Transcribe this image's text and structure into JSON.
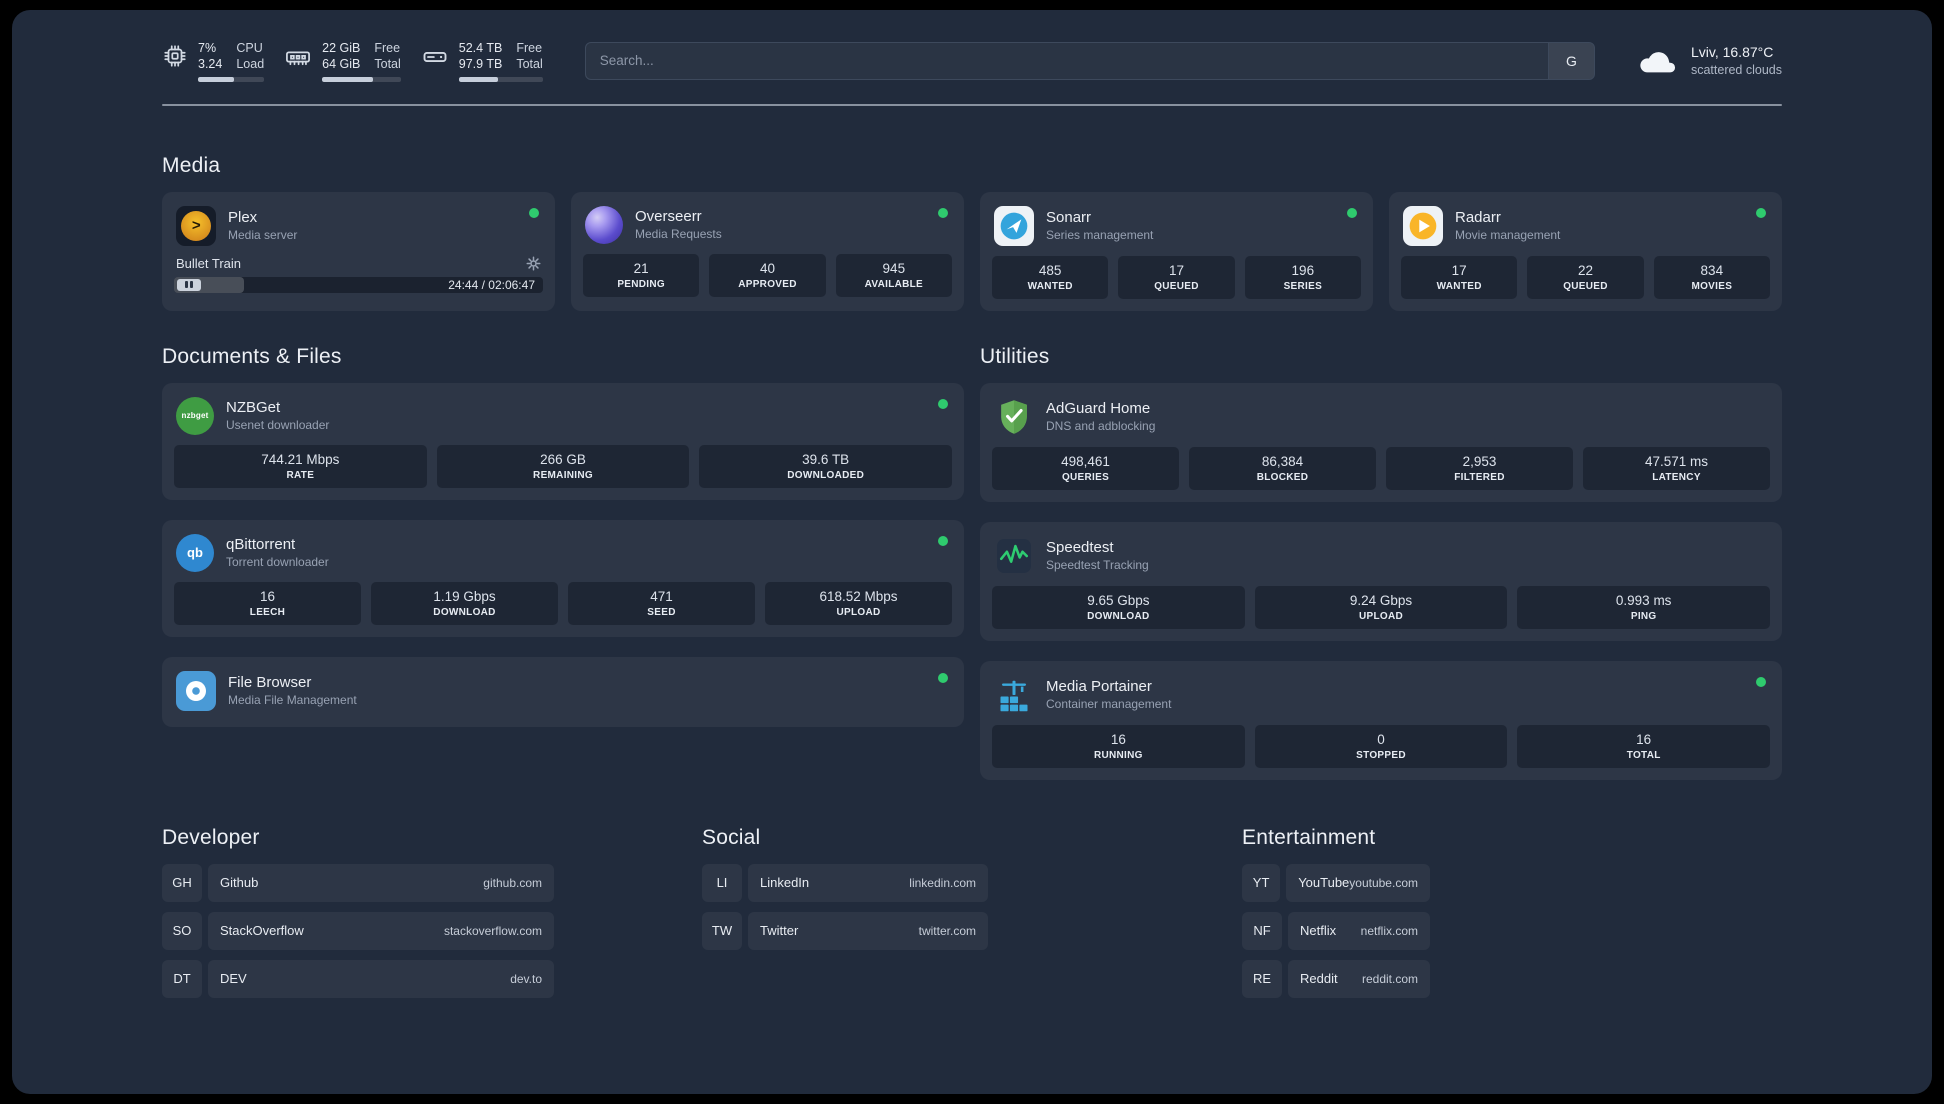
{
  "colors": {
    "background": "#212b3c",
    "card": "rgba(255,255,255,0.055)",
    "status_online": "#2fcb6e",
    "progress_fill": "#c6cedb"
  },
  "icons": {
    "topbar": [
      "cpu-icon",
      "memory-icon",
      "disk-icon"
    ],
    "weather": "cloud-icon",
    "plex_glyph": ">",
    "nzbget_label": "nzbget",
    "qbittorrent_label": "qb"
  },
  "topbar": {
    "cpu": {
      "percent": "7%",
      "load": "3.24",
      "label1": "CPU",
      "label2": "Load",
      "bar_pct": 55
    },
    "memory": {
      "value1": "22 GiB",
      "value2": "64 GiB",
      "label1": "Free",
      "label2": "Total",
      "bar_pct": 65
    },
    "disk": {
      "value1": "52.4 TB",
      "value2": "97.9 TB",
      "label1": "Free",
      "label2": "Total",
      "bar_pct": 47
    },
    "search": {
      "placeholder": "Search...",
      "provider_label": "G"
    },
    "weather": {
      "location": "Lviv, 16.87°C",
      "condition": "scattered clouds"
    }
  },
  "sections": {
    "media": "Media",
    "documents": "Documents & Files",
    "utilities": "Utilities"
  },
  "apps": {
    "plex": {
      "name": "Plex",
      "subtitle": "Media server",
      "player": {
        "title": "Bullet Train",
        "time": "24:44 / 02:06:47",
        "progress_pct": 19
      }
    },
    "overseerr": {
      "name": "Overseerr",
      "subtitle": "Media Requests",
      "stats": [
        {
          "value": "21",
          "label": "PENDING"
        },
        {
          "value": "40",
          "label": "APPROVED"
        },
        {
          "value": "945",
          "label": "AVAILABLE"
        }
      ]
    },
    "sonarr": {
      "name": "Sonarr",
      "subtitle": "Series management",
      "stats": [
        {
          "value": "485",
          "label": "WANTED"
        },
        {
          "value": "17",
          "label": "QUEUED"
        },
        {
          "value": "196",
          "label": "SERIES"
        }
      ]
    },
    "radarr": {
      "name": "Radarr",
      "subtitle": "Movie management",
      "stats": [
        {
          "value": "17",
          "label": "WANTED"
        },
        {
          "value": "22",
          "label": "QUEUED"
        },
        {
          "value": "834",
          "label": "MOVIES"
        }
      ]
    },
    "nzbget": {
      "name": "NZBGet",
      "subtitle": "Usenet downloader",
      "stats": [
        {
          "value": "744.21 Mbps",
          "label": "RATE"
        },
        {
          "value": "266 GB",
          "label": "REMAINING"
        },
        {
          "value": "39.6 TB",
          "label": "DOWNLOADED"
        }
      ]
    },
    "qbittorrent": {
      "name": "qBittorrent",
      "subtitle": "Torrent downloader",
      "stats": [
        {
          "value": "16",
          "label": "LEECH"
        },
        {
          "value": "1.19 Gbps",
          "label": "DOWNLOAD"
        },
        {
          "value": "471",
          "label": "SEED"
        },
        {
          "value": "618.52 Mbps",
          "label": "UPLOAD"
        }
      ]
    },
    "filebrowser": {
      "name": "File Browser",
      "subtitle": "Media File Management"
    },
    "adguard": {
      "name": "AdGuard Home",
      "subtitle": "DNS and adblocking",
      "stats": [
        {
          "value": "498,461",
          "label": "QUERIES"
        },
        {
          "value": "86,384",
          "label": "BLOCKED"
        },
        {
          "value": "2,953",
          "label": "FILTERED"
        },
        {
          "value": "47.571 ms",
          "label": "LATENCY"
        }
      ]
    },
    "speedtest": {
      "name": "Speedtest",
      "subtitle": "Speedtest Tracking",
      "stats": [
        {
          "value": "9.65 Gbps",
          "label": "DOWNLOAD"
        },
        {
          "value": "9.24 Gbps",
          "label": "UPLOAD"
        },
        {
          "value": "0.993 ms",
          "label": "PING"
        }
      ]
    },
    "portainer": {
      "name": "Media Portainer",
      "subtitle": "Container management",
      "stats": [
        {
          "value": "16",
          "label": "RUNNING"
        },
        {
          "value": "0",
          "label": "STOPPED"
        },
        {
          "value": "16",
          "label": "TOTAL"
        }
      ]
    }
  },
  "bookmarks": {
    "developer": {
      "title": "Developer",
      "items": [
        {
          "abbr": "GH",
          "name": "Github",
          "url": "github.com"
        },
        {
          "abbr": "SO",
          "name": "StackOverflow",
          "url": "stackoverflow.com"
        },
        {
          "abbr": "DT",
          "name": "DEV",
          "url": "dev.to"
        }
      ]
    },
    "social": {
      "title": "Social",
      "items": [
        {
          "abbr": "LI",
          "name": "LinkedIn",
          "url": "linkedin.com"
        },
        {
          "abbr": "TW",
          "name": "Twitter",
          "url": "twitter.com"
        }
      ]
    },
    "entertainment": {
      "title": "Entertainment",
      "items": [
        {
          "abbr": "YT",
          "name": "YouTube",
          "url": "youtube.com"
        },
        {
          "abbr": "NF",
          "name": "Netflix",
          "url": "netflix.com"
        },
        {
          "abbr": "RE",
          "name": "Reddit",
          "url": "reddit.com"
        }
      ]
    }
  }
}
